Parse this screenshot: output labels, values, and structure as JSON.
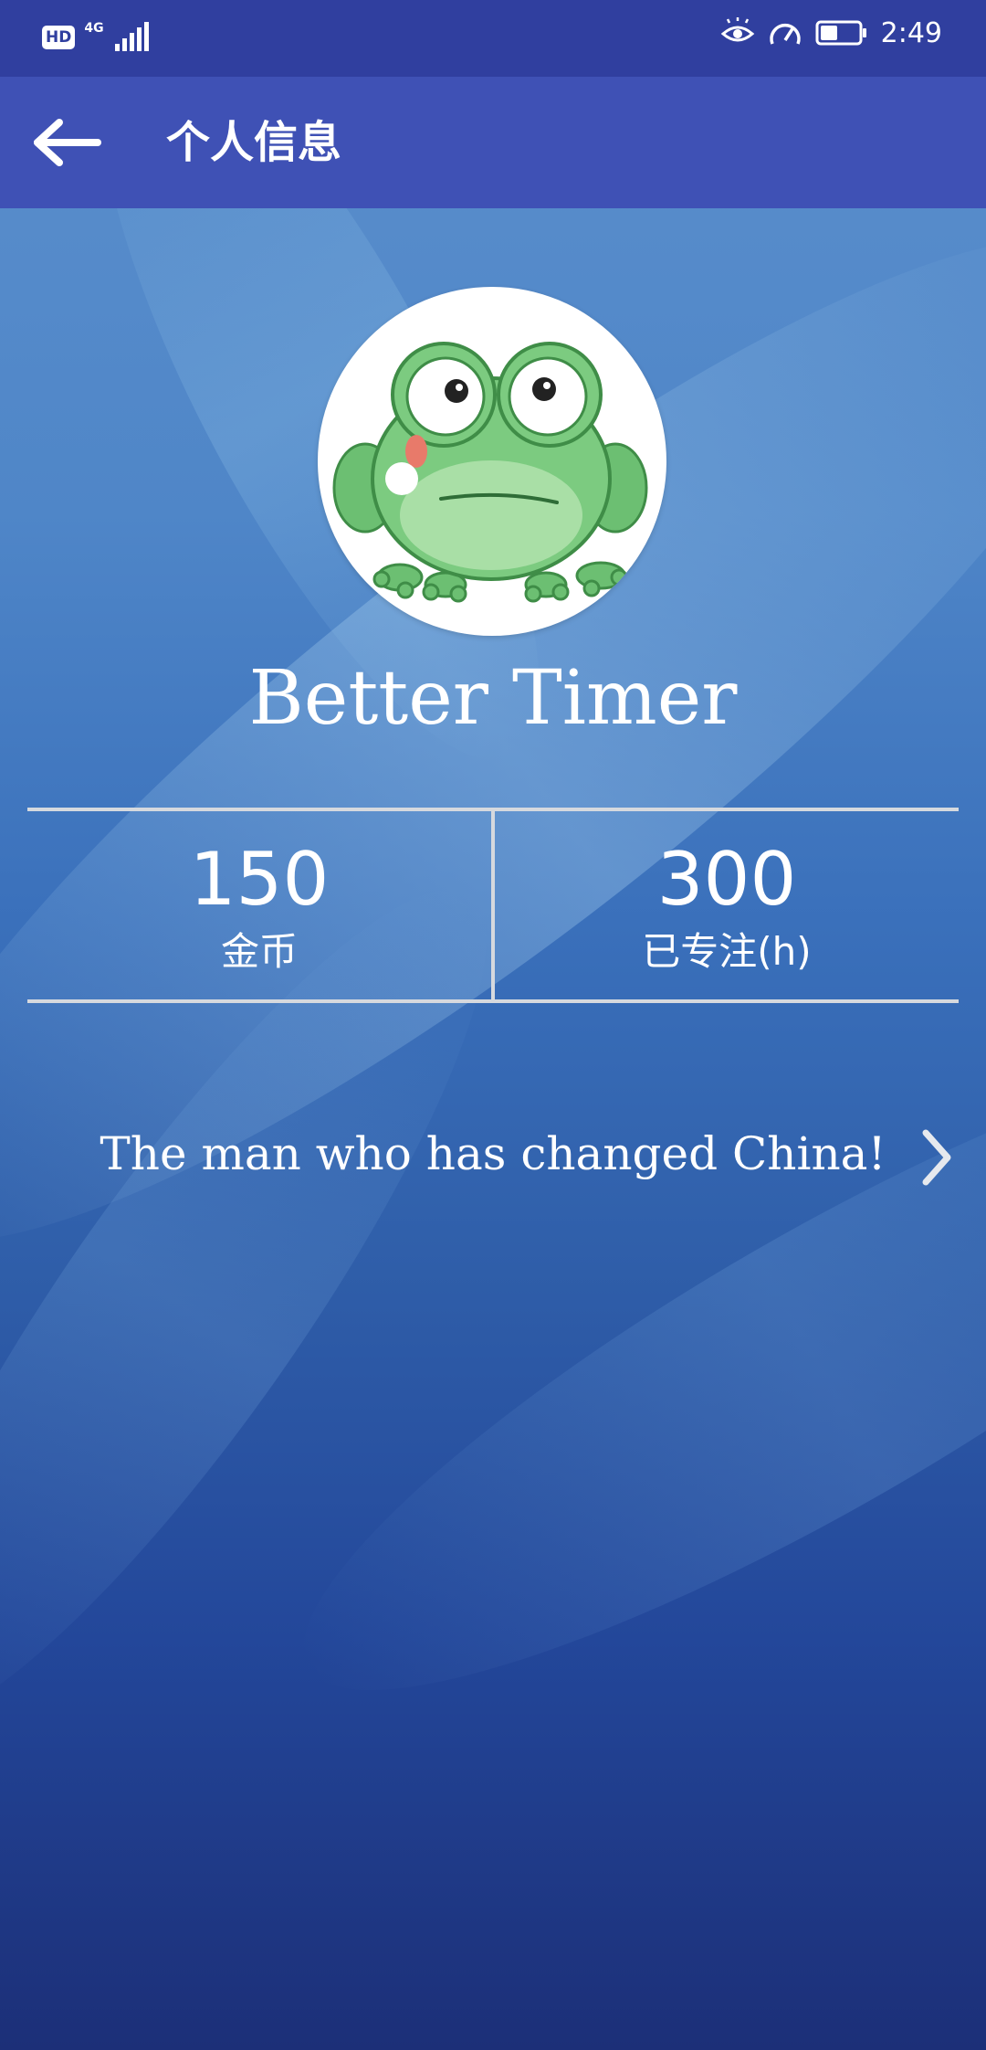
{
  "status_bar": {
    "hd": "HD",
    "network": "4G",
    "time": "2:49",
    "battery_level": 0.45
  },
  "app_bar": {
    "title": "个人信息"
  },
  "profile": {
    "username": "Better Timer",
    "stats": [
      {
        "value": "150",
        "label": "金币"
      },
      {
        "value": "300",
        "label": "已专注(h)"
      }
    ],
    "motto": "The man who has changed China!"
  },
  "colors": {
    "status_bar": "#303f9f",
    "app_bar": "#3f51b5",
    "divider": "#d6d9de",
    "text": "#ffffff"
  },
  "icons": {
    "back": "arrow-left-icon",
    "chevron": "chevron-right-icon",
    "avatar": "frog-avatar"
  }
}
